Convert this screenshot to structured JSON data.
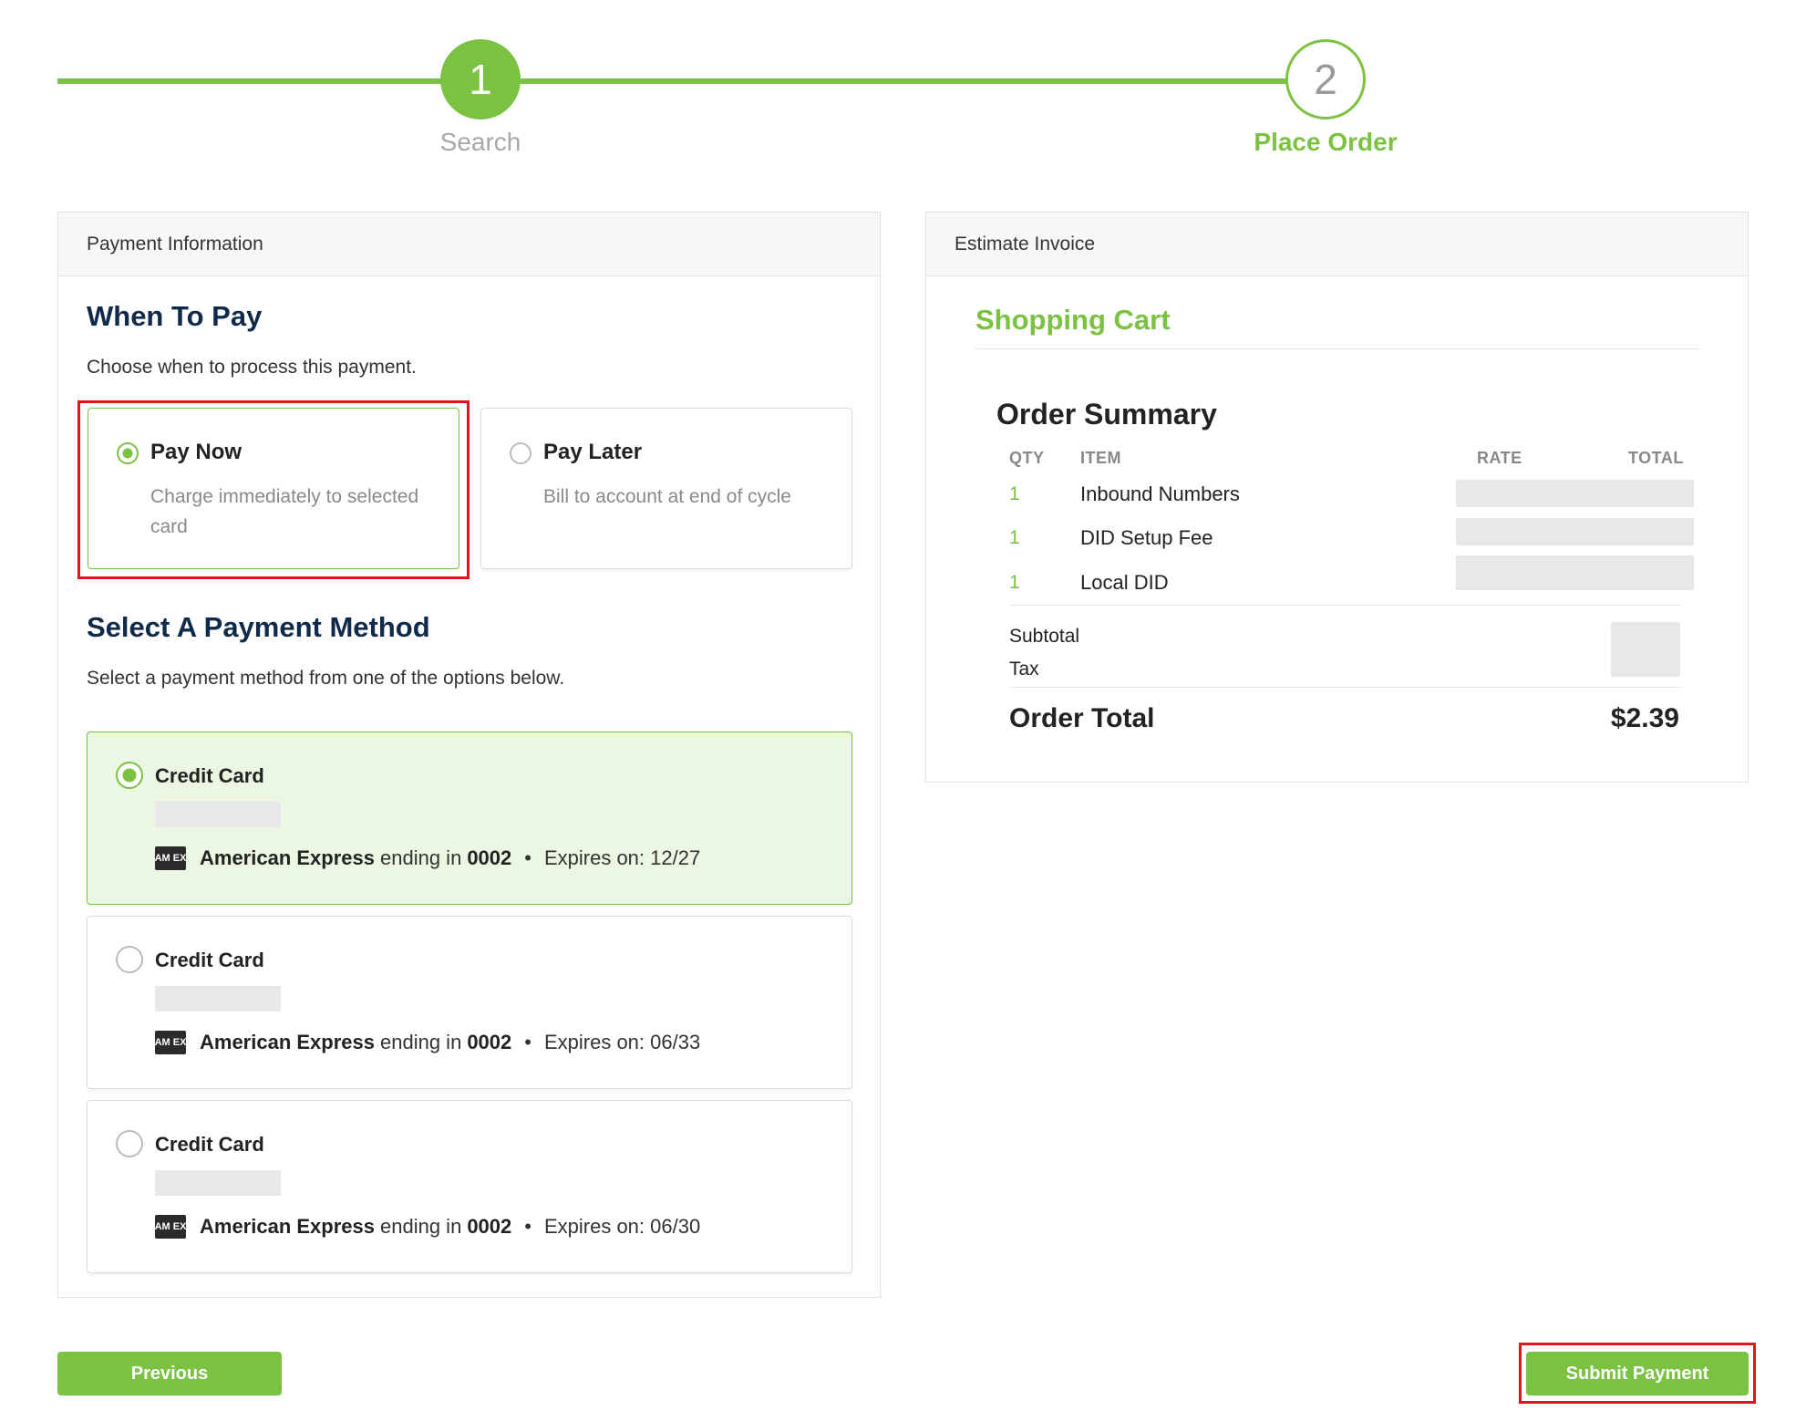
{
  "stepper": {
    "steps": [
      {
        "number": "1",
        "label": "Search",
        "state": "complete"
      },
      {
        "number": "2",
        "label": "Place Order",
        "state": "current"
      }
    ]
  },
  "payment": {
    "header": "Payment Information",
    "when_to_pay": {
      "title": "When To Pay",
      "description": "Choose when to process this payment.",
      "options": [
        {
          "title": "Pay Now",
          "desc": "Charge immediately to selected card",
          "selected": true
        },
        {
          "title": "Pay Later",
          "desc": "Bill to account at end of cycle",
          "selected": false
        }
      ]
    },
    "method": {
      "title": "Select A Payment Method",
      "description": "Select a payment method from one of the options below.",
      "cards": [
        {
          "title": "Credit Card",
          "brand": "American Express",
          "ending_text": "ending in",
          "last4": "0002",
          "separator": "•",
          "expires": "Expires on: 12/27",
          "selected": true
        },
        {
          "title": "Credit Card",
          "brand": "American Express",
          "ending_text": "ending in",
          "last4": "0002",
          "separator": "•",
          "expires": "Expires on: 06/33",
          "selected": false
        },
        {
          "title": "Credit Card",
          "brand": "American Express",
          "ending_text": "ending in",
          "last4": "0002",
          "separator": "•",
          "expires": "Expires on: 06/30",
          "selected": false
        }
      ],
      "card_icon_text": "AM EX"
    }
  },
  "invoice": {
    "header": "Estimate Invoice",
    "cart_title": "Shopping Cart",
    "summary_title": "Order Summary",
    "columns": {
      "qty": "QTY",
      "item": "ITEM",
      "rate": "RATE",
      "total": "TOTAL"
    },
    "items": [
      {
        "qty": "1",
        "item": "Inbound Numbers"
      },
      {
        "qty": "1",
        "item": "DID Setup Fee"
      },
      {
        "qty": "1",
        "item": "Local DID"
      }
    ],
    "subtotal_label": "Subtotal",
    "tax_label": "Tax",
    "total_label": "Order Total",
    "total_value": "$2.39"
  },
  "buttons": {
    "previous": "Previous",
    "submit": "Submit Payment"
  },
  "colors": {
    "accent": "#7cc242",
    "heading": "#102a4c",
    "highlight": "#e3151a",
    "selected_bg": "#ebf6e3"
  }
}
